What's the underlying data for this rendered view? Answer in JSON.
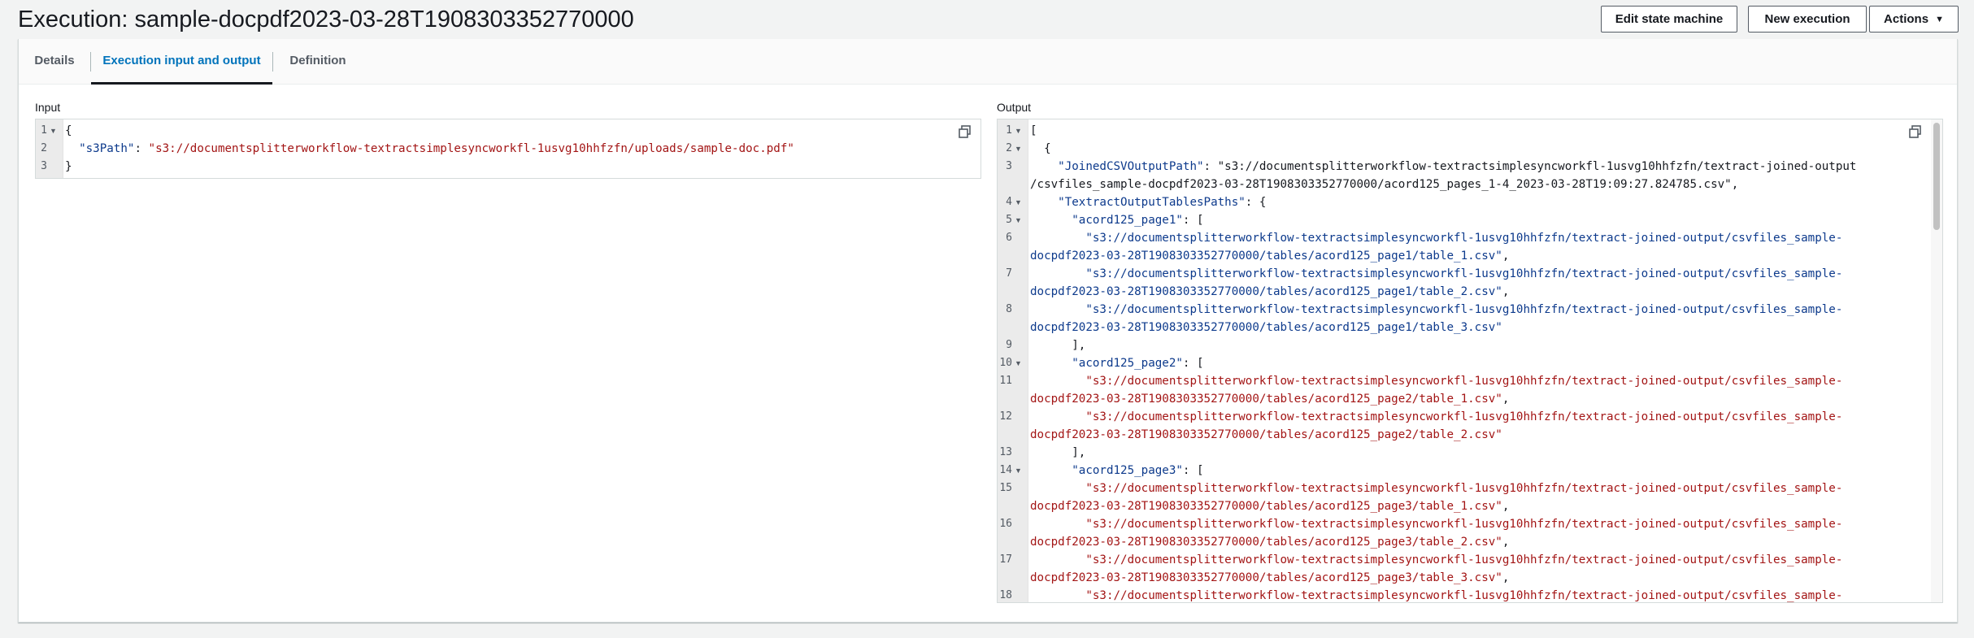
{
  "header": {
    "title": "Execution: sample-docpdf2023-03-28T1908303352770000",
    "buttons": {
      "edit_state_machine": "Edit state machine",
      "new_execution": "New execution",
      "actions": "Actions"
    }
  },
  "tabs": [
    {
      "label": "Details",
      "active": false
    },
    {
      "label": "Execution input and output",
      "active": true
    },
    {
      "label": "Definition",
      "active": false
    }
  ],
  "input": {
    "label": "Input",
    "lines": [
      {
        "n": "1",
        "fold": true,
        "parts": [
          {
            "t": "{",
            "c": "p"
          }
        ]
      },
      {
        "n": "2",
        "fold": false,
        "parts": [
          {
            "t": "  ",
            "c": "p"
          },
          {
            "t": "\"s3Path\"",
            "c": "k"
          },
          {
            "t": ": ",
            "c": "p"
          },
          {
            "t": "\"s3://documentsplitterworkflow-textractsimplesyncworkfl-1usvg10hhfzfn/uploads/sample-doc.pdf\"",
            "c": "s"
          }
        ]
      },
      {
        "n": "3",
        "fold": false,
        "parts": [
          {
            "t": "}",
            "c": "p"
          }
        ]
      }
    ]
  },
  "output": {
    "label": "Output",
    "lines": [
      {
        "n": "1",
        "fold": true,
        "parts": [
          {
            "t": "[",
            "c": "p"
          }
        ]
      },
      {
        "n": "2",
        "fold": true,
        "parts": [
          {
            "t": "  {",
            "c": "p"
          }
        ]
      },
      {
        "n": "3",
        "fold": false,
        "parts": [
          {
            "t": "    ",
            "c": "p"
          },
          {
            "t": "\"JoinedCSVOutputPath\"",
            "c": "k"
          },
          {
            "t": ": \"s3://documentsplitterworkflow-textractsimplesyncworkfl-1usvg10hhfzfn/textract-joined-output",
            "c": "p"
          }
        ]
      },
      {
        "n": "",
        "fold": false,
        "parts": [
          {
            "t": "/csvfiles_sample-docpdf2023-03-28T1908303352770000/acord125_pages_1-4_2023-03-28T19:09:27.824785.csv\",",
            "c": "p"
          }
        ]
      },
      {
        "n": "4",
        "fold": true,
        "parts": [
          {
            "t": "    ",
            "c": "p"
          },
          {
            "t": "\"TextractOutputTablesPaths\"",
            "c": "k"
          },
          {
            "t": ": {",
            "c": "p"
          }
        ]
      },
      {
        "n": "5",
        "fold": true,
        "parts": [
          {
            "t": "      ",
            "c": "p"
          },
          {
            "t": "\"acord125_page1\"",
            "c": "k"
          },
          {
            "t": ": [",
            "c": "p"
          }
        ]
      },
      {
        "n": "6",
        "fold": false,
        "parts": [
          {
            "t": "        \"s3://documentsplitterworkflow-textractsimplesyncworkfl-1usvg10hhfzfn/textract-joined-output/csvfiles_sample-",
            "c": "b"
          }
        ]
      },
      {
        "n": "",
        "fold": false,
        "parts": [
          {
            "t": "docpdf2023-03-28T1908303352770000/tables/acord125_page1/table_1.csv\"",
            "c": "b"
          },
          {
            "t": ",",
            "c": "p"
          }
        ]
      },
      {
        "n": "7",
        "fold": false,
        "parts": [
          {
            "t": "        \"s3://documentsplitterworkflow-textractsimplesyncworkfl-1usvg10hhfzfn/textract-joined-output/csvfiles_sample-",
            "c": "b"
          }
        ]
      },
      {
        "n": "",
        "fold": false,
        "parts": [
          {
            "t": "docpdf2023-03-28T1908303352770000/tables/acord125_page1/table_2.csv\"",
            "c": "b"
          },
          {
            "t": ",",
            "c": "p"
          }
        ]
      },
      {
        "n": "8",
        "fold": false,
        "parts": [
          {
            "t": "        \"s3://documentsplitterworkflow-textractsimplesyncworkfl-1usvg10hhfzfn/textract-joined-output/csvfiles_sample-",
            "c": "b"
          }
        ]
      },
      {
        "n": "",
        "fold": false,
        "parts": [
          {
            "t": "docpdf2023-03-28T1908303352770000/tables/acord125_page1/table_3.csv\"",
            "c": "b"
          }
        ]
      },
      {
        "n": "9",
        "fold": false,
        "parts": [
          {
            "t": "      ],",
            "c": "p"
          }
        ]
      },
      {
        "n": "10",
        "fold": true,
        "parts": [
          {
            "t": "      ",
            "c": "p"
          },
          {
            "t": "\"acord125_page2\"",
            "c": "k"
          },
          {
            "t": ": [",
            "c": "p"
          }
        ]
      },
      {
        "n": "11",
        "fold": false,
        "parts": [
          {
            "t": "        \"s3://documentsplitterworkflow-textractsimplesyncworkfl-1usvg10hhfzfn/textract-joined-output/csvfiles_sample-",
            "c": "s"
          }
        ]
      },
      {
        "n": "",
        "fold": false,
        "parts": [
          {
            "t": "docpdf2023-03-28T1908303352770000/tables/acord125_page2/table_1.csv\"",
            "c": "s"
          },
          {
            "t": ",",
            "c": "p"
          }
        ]
      },
      {
        "n": "12",
        "fold": false,
        "parts": [
          {
            "t": "        \"s3://documentsplitterworkflow-textractsimplesyncworkfl-1usvg10hhfzfn/textract-joined-output/csvfiles_sample-",
            "c": "s"
          }
        ]
      },
      {
        "n": "",
        "fold": false,
        "parts": [
          {
            "t": "docpdf2023-03-28T1908303352770000/tables/acord125_page2/table_2.csv\"",
            "c": "s"
          }
        ]
      },
      {
        "n": "13",
        "fold": false,
        "parts": [
          {
            "t": "      ],",
            "c": "p"
          }
        ]
      },
      {
        "n": "14",
        "fold": true,
        "parts": [
          {
            "t": "      ",
            "c": "p"
          },
          {
            "t": "\"acord125_page3\"",
            "c": "k"
          },
          {
            "t": ": [",
            "c": "p"
          }
        ]
      },
      {
        "n": "15",
        "fold": false,
        "parts": [
          {
            "t": "        \"s3://documentsplitterworkflow-textractsimplesyncworkfl-1usvg10hhfzfn/textract-joined-output/csvfiles_sample-",
            "c": "s"
          }
        ]
      },
      {
        "n": "",
        "fold": false,
        "parts": [
          {
            "t": "docpdf2023-03-28T1908303352770000/tables/acord125_page3/table_1.csv\"",
            "c": "s"
          },
          {
            "t": ",",
            "c": "p"
          }
        ]
      },
      {
        "n": "16",
        "fold": false,
        "parts": [
          {
            "t": "        \"s3://documentsplitterworkflow-textractsimplesyncworkfl-1usvg10hhfzfn/textract-joined-output/csvfiles_sample-",
            "c": "s"
          }
        ]
      },
      {
        "n": "",
        "fold": false,
        "parts": [
          {
            "t": "docpdf2023-03-28T1908303352770000/tables/acord125_page3/table_2.csv\"",
            "c": "s"
          },
          {
            "t": ",",
            "c": "p"
          }
        ]
      },
      {
        "n": "17",
        "fold": false,
        "parts": [
          {
            "t": "        \"s3://documentsplitterworkflow-textractsimplesyncworkfl-1usvg10hhfzfn/textract-joined-output/csvfiles_sample-",
            "c": "s"
          }
        ]
      },
      {
        "n": "",
        "fold": false,
        "parts": [
          {
            "t": "docpdf2023-03-28T1908303352770000/tables/acord125_page3/table_3.csv\"",
            "c": "s"
          },
          {
            "t": ",",
            "c": "p"
          }
        ]
      },
      {
        "n": "18",
        "fold": false,
        "parts": [
          {
            "t": "        \"s3://documentsplitterworkflow-textractsimplesyncworkfl-1usvg10hhfzfn/textract-joined-output/csvfiles_sample-",
            "c": "s"
          }
        ]
      }
    ]
  },
  "icons": {
    "copy": "copy-icon",
    "fold": "fold-arrow-icon",
    "caret": "caret-down-icon"
  },
  "colors": {
    "tab_active": "#0073bb",
    "key": "#0d3a8c",
    "string": "#a31515"
  }
}
